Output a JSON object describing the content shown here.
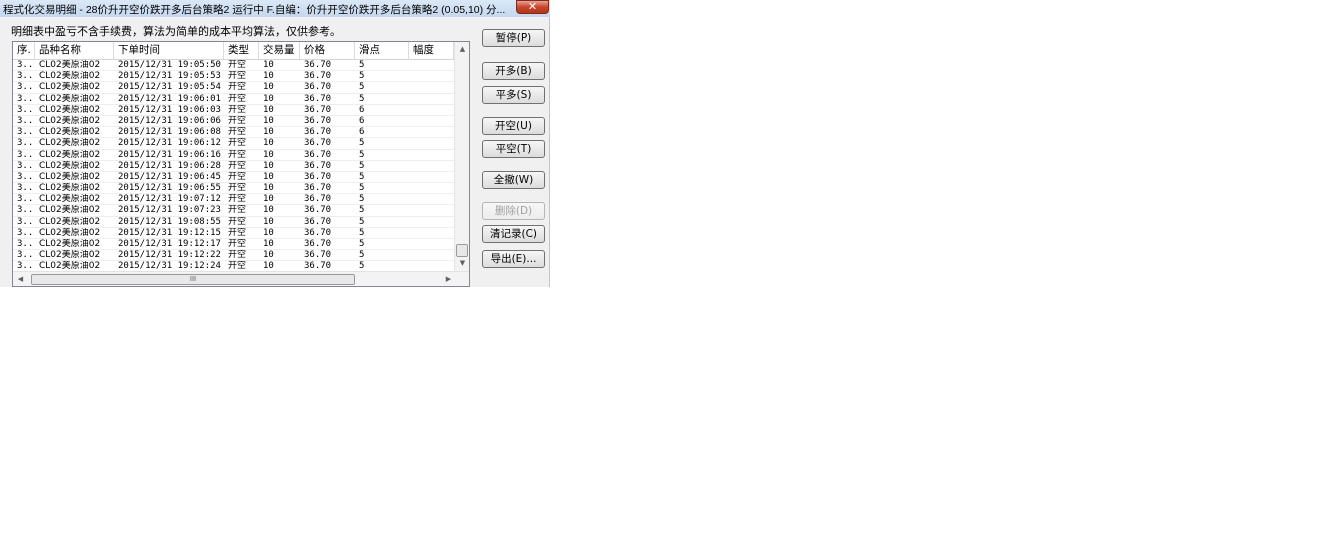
{
  "window": {
    "title": "程式化交易明细 - 28价升开空价跌开多后台策略2 运行中  F.自编：价升开空价跌开多后台策略2 (0.05,10) 分...",
    "close_glyph": "✕",
    "note": "明细表中盈亏不含手续费，算法为简单的成本平均算法，仅供参考。"
  },
  "table": {
    "columns": [
      "序.",
      "品种名称",
      "下单时间",
      "类型",
      "交易量",
      "价格",
      "滑点",
      "幅度"
    ],
    "rows": [
      [
        "3..",
        "CL02美原油02",
        "2015/12/31 19:05:50",
        "开空",
        "10",
        "36.70",
        "5",
        ""
      ],
      [
        "3..",
        "CL02美原油02",
        "2015/12/31 19:05:53",
        "开空",
        "10",
        "36.70",
        "5",
        ""
      ],
      [
        "3..",
        "CL02美原油02",
        "2015/12/31 19:05:54",
        "开空",
        "10",
        "36.70",
        "5",
        ""
      ],
      [
        "3..",
        "CL02美原油02",
        "2015/12/31 19:06:01",
        "开空",
        "10",
        "36.70",
        "5",
        ""
      ],
      [
        "3..",
        "CL02美原油02",
        "2015/12/31 19:06:03",
        "开空",
        "10",
        "36.70",
        "6",
        ""
      ],
      [
        "3..",
        "CL02美原油02",
        "2015/12/31 19:06:06",
        "开空",
        "10",
        "36.70",
        "6",
        ""
      ],
      [
        "3..",
        "CL02美原油02",
        "2015/12/31 19:06:08",
        "开空",
        "10",
        "36.70",
        "6",
        ""
      ],
      [
        "3..",
        "CL02美原油02",
        "2015/12/31 19:06:12",
        "开空",
        "10",
        "36.70",
        "5",
        ""
      ],
      [
        "3..",
        "CL02美原油02",
        "2015/12/31 19:06:16",
        "开空",
        "10",
        "36.70",
        "5",
        ""
      ],
      [
        "3..",
        "CL02美原油02",
        "2015/12/31 19:06:28",
        "开空",
        "10",
        "36.70",
        "5",
        ""
      ],
      [
        "3..",
        "CL02美原油02",
        "2015/12/31 19:06:45",
        "开空",
        "10",
        "36.70",
        "5",
        ""
      ],
      [
        "3..",
        "CL02美原油02",
        "2015/12/31 19:06:55",
        "开空",
        "10",
        "36.70",
        "5",
        ""
      ],
      [
        "3..",
        "CL02美原油02",
        "2015/12/31 19:07:12",
        "开空",
        "10",
        "36.70",
        "5",
        ""
      ],
      [
        "3..",
        "CL02美原油02",
        "2015/12/31 19:07:23",
        "开空",
        "10",
        "36.70",
        "5",
        ""
      ],
      [
        "3..",
        "CL02美原油02",
        "2015/12/31 19:08:55",
        "开空",
        "10",
        "36.70",
        "5",
        ""
      ],
      [
        "3..",
        "CL02美原油02",
        "2015/12/31 19:12:15",
        "开空",
        "10",
        "36.70",
        "5",
        ""
      ],
      [
        "3..",
        "CL02美原油02",
        "2015/12/31 19:12:17",
        "开空",
        "10",
        "36.70",
        "5",
        ""
      ],
      [
        "3..",
        "CL02美原油02",
        "2015/12/31 19:12:22",
        "开空",
        "10",
        "36.70",
        "5",
        ""
      ],
      [
        "3..",
        "CL02美原油02",
        "2015/12/31 19:12:24",
        "开空",
        "10",
        "36.70",
        "5",
        ""
      ]
    ]
  },
  "scroll": {
    "up_glyph": "▲",
    "down_glyph": "▼",
    "left_glyph": "◀",
    "right_glyph": "▶",
    "grip": "III"
  },
  "buttons": {
    "pause": "暂停(P)",
    "open_long": "开多(B)",
    "close_long": "平多(S)",
    "open_short": "开空(U)",
    "close_short": "平空(T)",
    "cancel_all": "全撤(W)",
    "delete": "删除(D)",
    "clear_log": "清记录(C)",
    "export": "导出(E)..."
  }
}
